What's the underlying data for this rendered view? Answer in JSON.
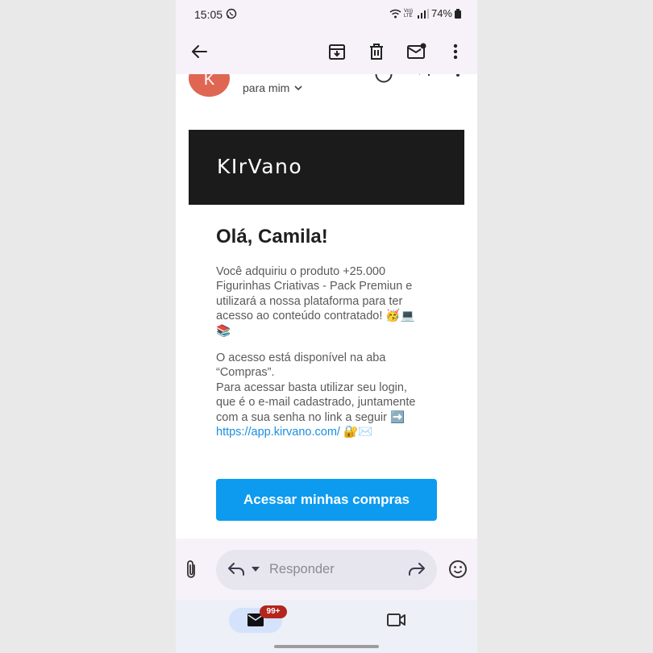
{
  "status_bar": {
    "time": "15:05",
    "network": "Vo)) LTE",
    "battery": "74%"
  },
  "email": {
    "sender_initial": "K",
    "recipient_label": "para mim",
    "brand_logo": "KIrVano",
    "greeting": "Olá, Camila!",
    "paragraph1_lines": [
      "Você adquiriu o produto +25.000",
      "Figurinhas Criativas - Pack Premiun e",
      "utilizará a nossa plataforma para ter",
      "acesso ao conteúdo contratado! 🥳💻",
      "📚"
    ],
    "paragraph2_lines": [
      "O acesso está disponível na aba",
      "“Compras”.",
      "Para acessar basta utilizar seu login,",
      "que é o e-mail cadastrado, juntamente",
      "com a sua senha no link a seguir ➡️"
    ],
    "link_text": "https://app.kirvano.com/",
    "link_emoji": "🔐✉️",
    "cta_label": "Acessar minhas compras"
  },
  "reply_bar": {
    "placeholder": "Responder"
  },
  "bottom_nav": {
    "mail_badge": "99+"
  },
  "colors": {
    "avatar": "#e06654",
    "banner": "#1b1b1b",
    "cta": "#0d9bf0",
    "link": "#1a8fe0",
    "badge": "#b3261e"
  }
}
